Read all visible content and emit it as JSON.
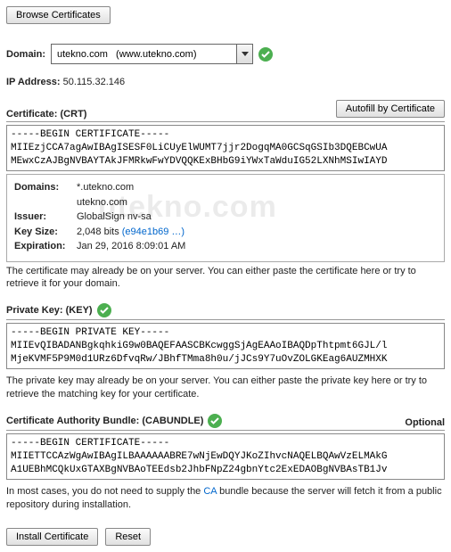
{
  "watermark": "utekno.com",
  "buttons": {
    "browse": "Browse Certificates",
    "autofill": "Autofill by Certificate",
    "install": "Install Certificate",
    "reset": "Reset"
  },
  "domain": {
    "label": "Domain:",
    "value": "utekno.com   (www.utekno.com)"
  },
  "ip": {
    "label": "IP Address:",
    "value": "50.115.32.146"
  },
  "crt": {
    "title": "Certificate: (CRT)",
    "text": "-----BEGIN CERTIFICATE-----\nMIIEzjCCA7agAwIBAgISESF0LiCUyElWUMT7jjr2DogqMA0GCSqGSIb3DQEBCwUA\nMEwxCzAJBgNVBAYTAkJFMRkwFwYDVQQKExBHbG9iYWxTaWduIG52LXNhMSIwIAYD",
    "info": {
      "domains_label": "Domains:",
      "domains_1": "*.utekno.com",
      "domains_2": "utekno.com",
      "issuer_label": "Issuer:",
      "issuer": "GlobalSign nv-sa",
      "keysize_label": "Key Size:",
      "keysize": "2,048 bits ",
      "keysize_hash": "(e94e1b69 …)",
      "exp_label": "Expiration:",
      "exp": "Jan 29, 2016 8:09:01 AM"
    },
    "help": "The certificate may already be on your server. You can either paste the certificate here or try to retrieve it for your domain."
  },
  "pkey": {
    "title": "Private Key: (KEY)",
    "text": "-----BEGIN PRIVATE KEY-----\nMIIEvQIBADANBgkqhkiG9w0BAQEFAASCBKcwggSjAgEAAoIBAQDpThtpmt6GJL/l\nMjeKVMF5P9M0d1URz6DfvqRw/JBhfTMma8h0u/jJCs9Y7uOvZOLGKEag6AUZMHXK",
    "help": "The private key may already be on your server. You can either paste the private key here or try to retrieve the matching key for your certificate."
  },
  "cab": {
    "title": "Certificate Authority Bundle: (CABUNDLE)",
    "optional": "Optional",
    "text": "-----BEGIN CERTIFICATE-----\nMIIETTCCAzWgAwIBAgILBAAAAAABRE7wNjEwDQYJKoZIhvcNAQELBQAwVzELMAkG\nA1UEBhMCQkUxGTAXBgNVBAoTEEdsb2JhbFNpZ24gbnYtc2ExEDAOBgNVBAsTB1Jv",
    "help_pre": "In most cases, you do not need to supply the ",
    "help_link": "CA",
    "help_post": " bundle because the server will fetch it from a public repository during installation."
  }
}
